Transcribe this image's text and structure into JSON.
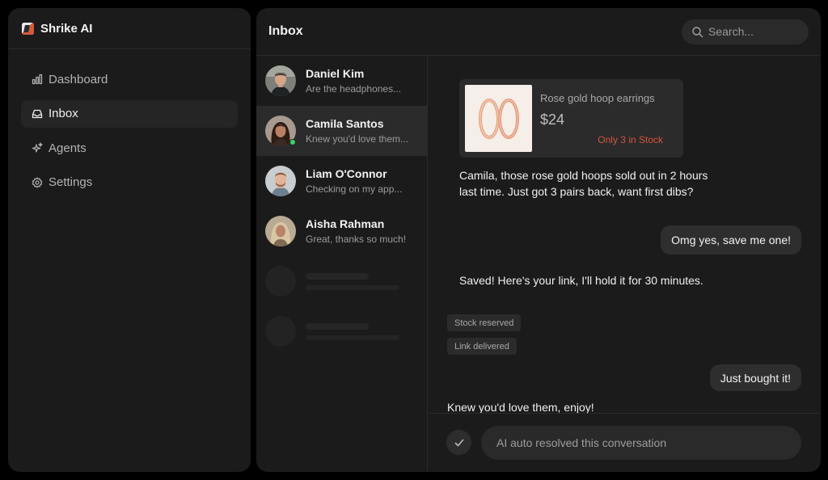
{
  "app": {
    "name": "Shrike AI"
  },
  "sidebar": {
    "items": [
      {
        "label": "Dashboard",
        "icon": "bar-chart-icon",
        "active": false
      },
      {
        "label": "Inbox",
        "icon": "inbox-icon",
        "active": true
      },
      {
        "label": "Agents",
        "icon": "sparkles-icon",
        "active": false
      },
      {
        "label": "Settings",
        "icon": "gear-icon",
        "active": false
      }
    ]
  },
  "header": {
    "title": "Inbox",
    "search_placeholder": "Search..."
  },
  "conversations": [
    {
      "name": "Daniel Kim",
      "preview": "Are the headphones...",
      "active": false,
      "online": false
    },
    {
      "name": "Camila Santos",
      "preview": "Knew you'd love them...",
      "active": true,
      "online": true
    },
    {
      "name": "Liam O'Connor",
      "preview": "Checking on my app...",
      "active": false,
      "online": false
    },
    {
      "name": "Aisha Rahman",
      "preview": "Great, thanks so much!",
      "active": false,
      "online": false
    }
  ],
  "chat": {
    "product": {
      "name": "Rose gold hoop earrings",
      "price": "$24",
      "stock": "Only 3 in Stock"
    },
    "messages": {
      "m1_line1": "Camila, those rose gold hoops sold out in 2 hours",
      "m1_line2": "last time. Just got 3 pairs back, want first dibs?",
      "m2": "Omg yes, save me one!",
      "m3": "Saved! Here's your link, I'll hold it for 30 minutes.",
      "m4": "Just bought it!",
      "m5": "Knew you'd love them, enjoy!"
    },
    "tags": [
      "Stock reserved",
      "Link delivered"
    ],
    "resolved_text": "AI auto resolved this conversation"
  },
  "colors": {
    "accent_stock": "#d4533b",
    "online": "#3fcf6a"
  }
}
